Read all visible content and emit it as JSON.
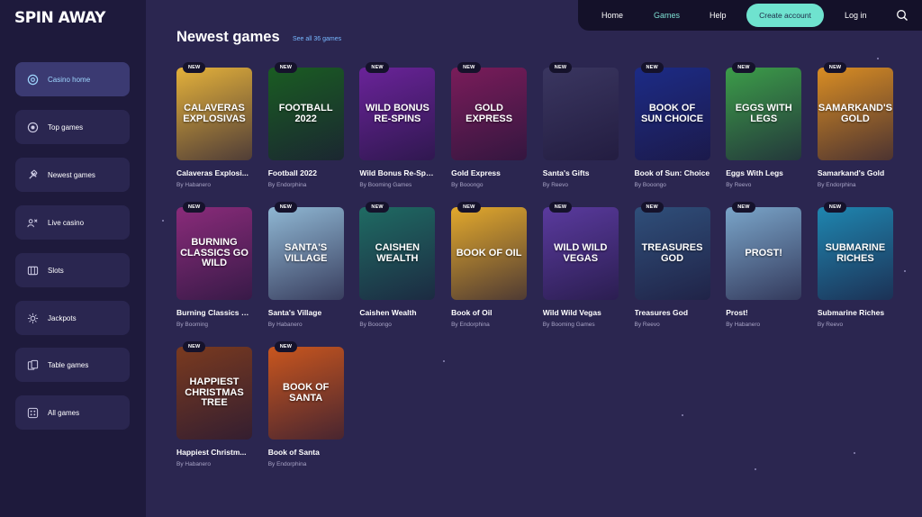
{
  "logo": "SPIN AWAY",
  "nav": {
    "home": "Home",
    "games": "Games",
    "help": "Help",
    "create_account": "Create account",
    "login": "Log in"
  },
  "sidebar": {
    "items": [
      {
        "label": "Casino home",
        "icon": "casino-home-icon"
      },
      {
        "label": "Top games",
        "icon": "top-games-icon"
      },
      {
        "label": "Newest games",
        "icon": "newest-games-icon"
      },
      {
        "label": "Live casino",
        "icon": "live-casino-icon"
      },
      {
        "label": "Slots",
        "icon": "slots-icon"
      },
      {
        "label": "Jackpots",
        "icon": "jackpots-icon"
      },
      {
        "label": "Table games",
        "icon": "table-games-icon"
      },
      {
        "label": "All games",
        "icon": "all-games-icon"
      }
    ]
  },
  "section": {
    "title": "Newest games",
    "see_all": "See all 36 games"
  },
  "badge_text": "NEW",
  "games": [
    {
      "title": "Calaveras Explosi...",
      "provider": "By Habanero",
      "art": "Calaveras Explosivas",
      "bg": "#e4b13a"
    },
    {
      "title": "Football 2022",
      "provider": "By Endorphina",
      "art": "FOOTBALL 2022",
      "bg": "#1a5c22"
    },
    {
      "title": "Wild Bonus Re-Spins",
      "provider": "By Booming Games",
      "art": "WILD BONUS RE-SPINS",
      "bg": "#6a2399"
    },
    {
      "title": "Gold Express",
      "provider": "By Booongo",
      "art": "GOLD EXPRESS",
      "bg": "#7a1c5a"
    },
    {
      "title": "Santa's Gifts",
      "provider": "By Reevo",
      "art": "",
      "bg": "#3a3660"
    },
    {
      "title": "Book of Sun: Choice",
      "provider": "By Booongo",
      "art": "BOOK OF SUN CHOICE",
      "bg": "#1c2b86"
    },
    {
      "title": "Eggs With Legs",
      "provider": "By Reevo",
      "art": "EGGS WITH LEGS",
      "bg": "#3c9d49"
    },
    {
      "title": "Samarkand's Gold",
      "provider": "By Endorphina",
      "art": "SAMARKAND'S GOLD",
      "bg": "#d98d23"
    },
    {
      "title": "Burning Classics g...",
      "provider": "By Booming",
      "art": "Burning Classics Go Wild",
      "bg": "#8a2b7a"
    },
    {
      "title": "Santa's Village",
      "provider": "By Habanero",
      "art": "Santa's Village",
      "bg": "#8fb7d3"
    },
    {
      "title": "Caishen Wealth",
      "provider": "By Booongo",
      "art": "CAISHEN WEALTH",
      "bg": "#1f6b63"
    },
    {
      "title": "Book of Oil",
      "provider": "By Endorphina",
      "art": "BOOK OF OIL",
      "bg": "#e3a92c"
    },
    {
      "title": "Wild Wild Vegas",
      "provider": "By Booming Games",
      "art": "WILD WILD VEGAS",
      "bg": "#5a3a9e"
    },
    {
      "title": "Treasures God",
      "provider": "By Reevo",
      "art": "TREASURES GOD",
      "bg": "#2f4f7a"
    },
    {
      "title": "Prost!",
      "provider": "By Habanero",
      "art": "Prost!",
      "bg": "#7aa5c9"
    },
    {
      "title": "Submarine Riches",
      "provider": "By Reevo",
      "art": "Submarine Riches",
      "bg": "#1f86b0"
    },
    {
      "title": "Happiest Christm...",
      "provider": "By Habanero",
      "art": "Happiest Christmas TREE",
      "bg": "#7a3a1f"
    },
    {
      "title": "Book of Santa",
      "provider": "By Endorphina",
      "art": "Book of Santa",
      "bg": "#c9561e"
    }
  ]
}
